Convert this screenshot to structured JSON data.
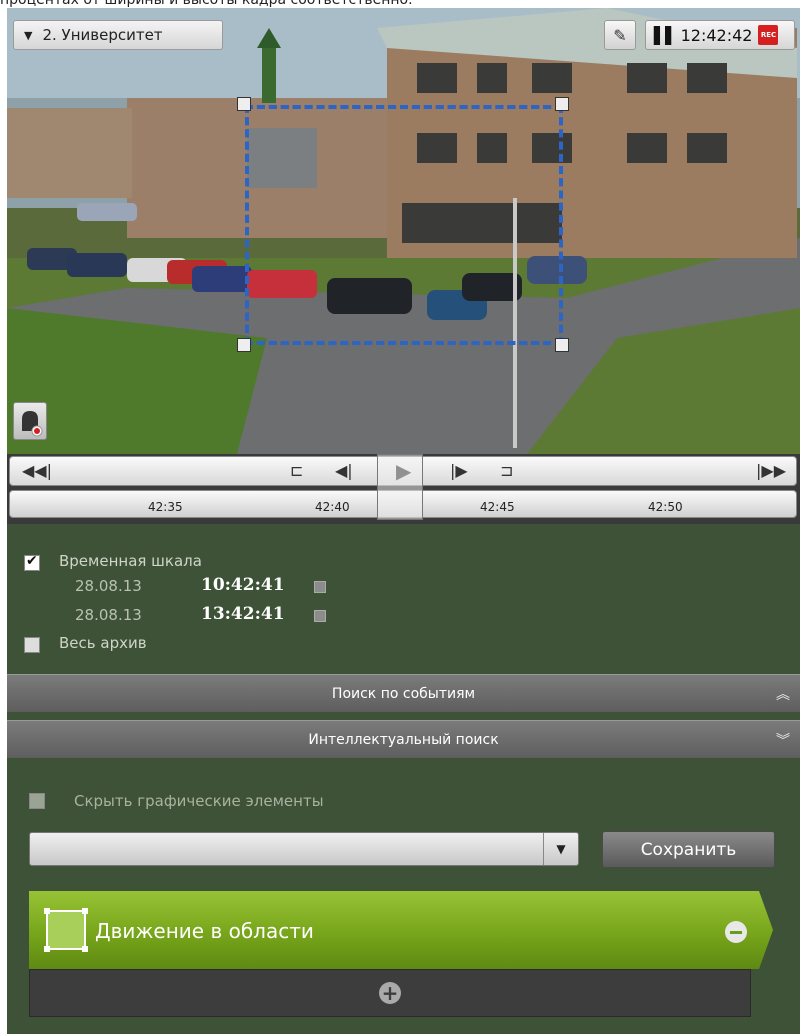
{
  "caption": "процентах от ширины и высоты кадра соответственно.",
  "camera": {
    "name": "2. Университет"
  },
  "clock": {
    "time": "12:42:42",
    "rec_label": "REC"
  },
  "player": {
    "buttons": {
      "to_start": "◀◀|",
      "frame_in": "⊏",
      "step_back": "◀|",
      "play": "▶",
      "step_fwd": "|▶",
      "frame_out": "⊐",
      "to_end": "|▶▶"
    },
    "ticks": [
      "42:35",
      "42:40",
      "42:45",
      "42:50"
    ]
  },
  "timescale": {
    "label": "Временная шкала",
    "checked": true,
    "from_date": "28.08.13",
    "from_time": "10:42:41",
    "to_date": "28.08.13",
    "to_time": "13:42:41",
    "all_archive_label": "Весь архив"
  },
  "sections": {
    "event_search": "Поиск по событиям",
    "smart_search": "Интеллектуальный поиск"
  },
  "smart": {
    "hide_graphics_label": "Скрыть графические элементы",
    "save_label": "Сохранить",
    "detector_label": "Движение в области"
  },
  "icons": {
    "dropdown": "chevron-down-icon",
    "edit": "pencil-icon",
    "alarm": "alarm-bell-icon",
    "collapse": "double-chevron-up-icon",
    "expand": "double-chevron-down-icon",
    "remove": "minus-circle-icon",
    "add": "plus-circle-icon"
  },
  "colors": {
    "panel_bg": "#3d5237",
    "detector_green": "#7aa81c",
    "roi_red": "#d41c1c",
    "roi_blue": "#2a66c8"
  }
}
